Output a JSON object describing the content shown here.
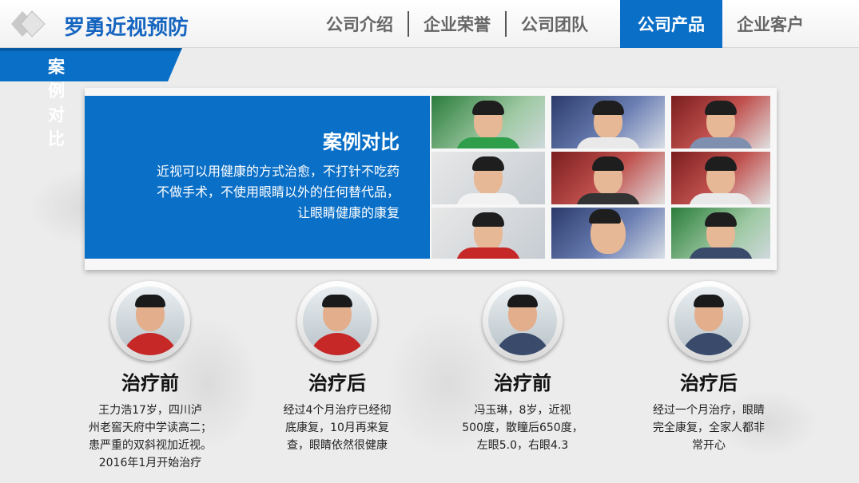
{
  "header": {
    "brand": "罗勇近视预防",
    "nav": [
      {
        "label": "公司介绍",
        "active": false
      },
      {
        "label": "企业荣誉",
        "active": false
      },
      {
        "label": "公司团队",
        "active": false
      },
      {
        "label": "公司产品",
        "active": true
      },
      {
        "label": "企业客户",
        "active": false
      }
    ]
  },
  "section": {
    "label": "案例对比"
  },
  "banner": {
    "title": "案例对比",
    "lines": [
      "近视可以用健康的方式治愈，不打针不吃药",
      "不做手术，不使用眼睛以外的任何替代品，",
      "让眼睛健康的康复"
    ]
  },
  "cases": [
    {
      "title": "治疗前",
      "lines": [
        "王力浩17岁，四川泸",
        "州老窖天府中学读高二；",
        "患严重的双斜视加近视。",
        "2016年1月开始治疗"
      ]
    },
    {
      "title": "治疗后",
      "lines": [
        "经过4个月治疗已经彻",
        "底康复，10月再来复",
        "查，眼睛依然很健康"
      ]
    },
    {
      "title": "治疗前",
      "lines": [
        "冯玉琳，8岁，近视",
        "500度，散瞳后650度，",
        "左眼5.0，右眼4.3"
      ]
    },
    {
      "title": "治疗后",
      "lines": [
        "经过一个月治疗，眼睛",
        "完全康复，全家人都非",
        "常开心"
      ]
    }
  ],
  "colors": {
    "accent": "#0a6fc7",
    "brand": "#1565c0"
  }
}
